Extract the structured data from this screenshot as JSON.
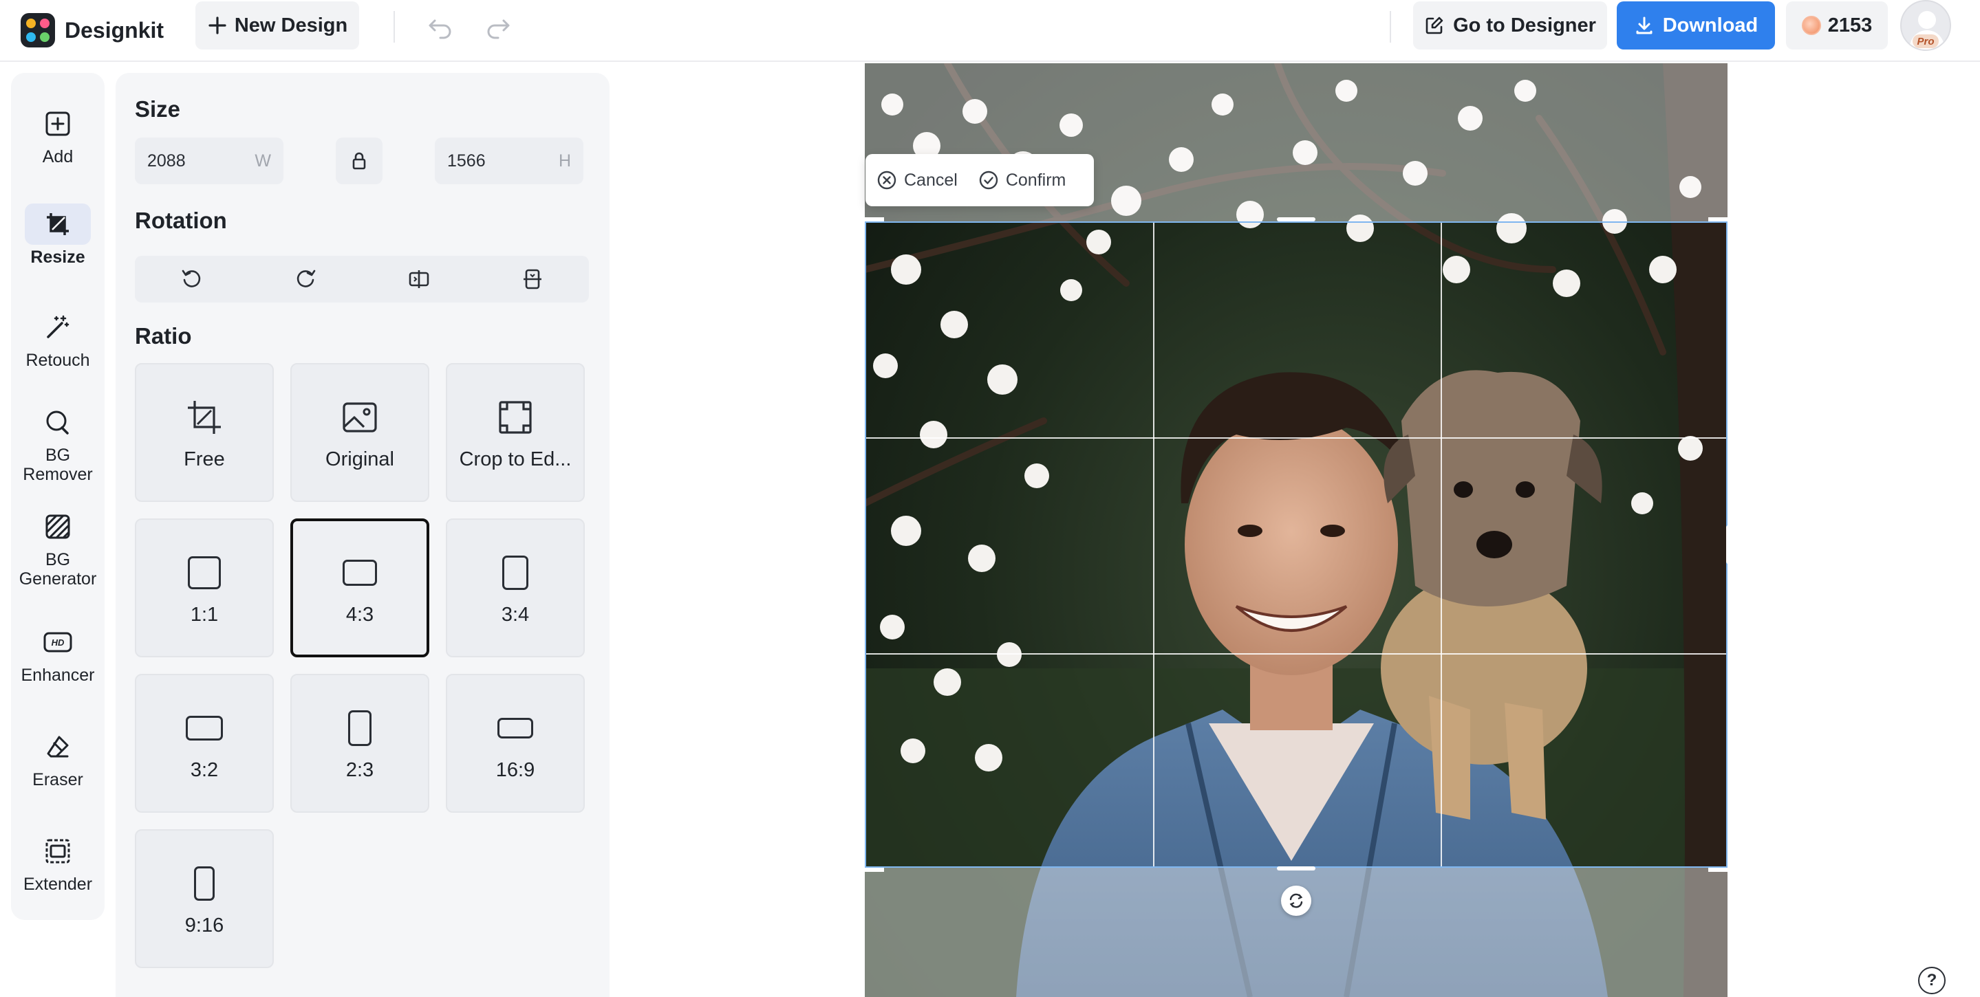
{
  "app": {
    "name": "Designkit"
  },
  "toolbar": {
    "new_design_label": "New Design",
    "go_to_designer_label": "Go to Designer",
    "download_label": "Download",
    "credits": "2153",
    "pro_label": "Pro"
  },
  "rail": {
    "items": [
      {
        "label": "Add",
        "icon": "plus-square-icon"
      },
      {
        "label": "Resize",
        "icon": "crop-icon",
        "active": true
      },
      {
        "label": "Retouch",
        "icon": "magic-wand-icon"
      },
      {
        "label": "BG Remover",
        "icon": "bg-remover-icon"
      },
      {
        "label": "BG Generator",
        "icon": "bg-generator-icon"
      },
      {
        "label": "Enhancer",
        "icon": "hd-icon"
      },
      {
        "label": "Eraser",
        "icon": "eraser-icon"
      },
      {
        "label": "Extender",
        "icon": "extender-icon"
      }
    ]
  },
  "panel": {
    "size": {
      "title": "Size",
      "width_value": "2088",
      "width_unit": "W",
      "height_value": "1566",
      "height_unit": "H"
    },
    "rotation": {
      "title": "Rotation"
    },
    "ratio": {
      "title": "Ratio",
      "options": [
        {
          "label": "Free",
          "icon": "free-crop-icon"
        },
        {
          "label": "Original",
          "icon": "image-icon"
        },
        {
          "label": "Crop to Ed...",
          "icon": "crop-to-edge-icon"
        },
        {
          "label": "1:1",
          "icon": "ratio-1-1-icon"
        },
        {
          "label": "4:3",
          "icon": "ratio-4-3-icon",
          "selected": true
        },
        {
          "label": "3:4",
          "icon": "ratio-3-4-icon"
        },
        {
          "label": "3:2",
          "icon": "ratio-3-2-icon"
        },
        {
          "label": "2:3",
          "icon": "ratio-2-3-icon"
        },
        {
          "label": "16:9",
          "icon": "ratio-16-9-icon"
        },
        {
          "label": "9:16",
          "icon": "ratio-9-16-icon"
        }
      ]
    }
  },
  "crop": {
    "cancel_label": "Cancel",
    "confirm_label": "Confirm"
  },
  "help": {
    "label": "?"
  },
  "colors": {
    "accent": "#2f80ed",
    "crop_border": "#7fb6ef",
    "panel_bg": "#f5f6f8"
  }
}
